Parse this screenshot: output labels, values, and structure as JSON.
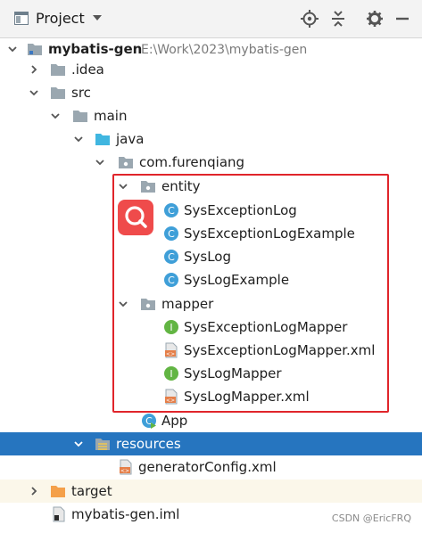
{
  "toolbar": {
    "title": "Project",
    "icons": [
      "locate-icon",
      "collapse-all-icon",
      "settings-gear-icon",
      "hide-icon"
    ]
  },
  "tree": {
    "root": {
      "name": "mybatis-gen",
      "path": "E:\\Work\\2023\\mybatis-gen"
    },
    "idea": ".idea",
    "src": "src",
    "main": "main",
    "java": "java",
    "package": "com.furenqiang",
    "entity": "entity",
    "entity_items": [
      "SysExceptionLog",
      "SysExceptionLogExample",
      "SysLog",
      "SysLogExample"
    ],
    "mapper": "mapper",
    "mapper_items": [
      {
        "label": "SysExceptionLogMapper",
        "kind": "interface"
      },
      {
        "label": "SysExceptionLogMapper.xml",
        "kind": "xml"
      },
      {
        "label": "SysLogMapper",
        "kind": "interface"
      },
      {
        "label": "SysLogMapper.xml",
        "kind": "xml"
      }
    ],
    "app": "App",
    "resources": "resources",
    "generator_config": "generatorConfig.xml",
    "target": "target",
    "iml": "mybatis-gen.iml"
  },
  "colors": {
    "selection": "#2675bf",
    "highlight_box": "#e0252b",
    "class_icon": "#3f9fd8",
    "interface_icon": "#62b543",
    "folder_gray": "#9aa7b0",
    "folder_blue": "#40b6e0",
    "folder_orange": "#f4a04a"
  },
  "watermark": "CSDN @EricFRQ"
}
